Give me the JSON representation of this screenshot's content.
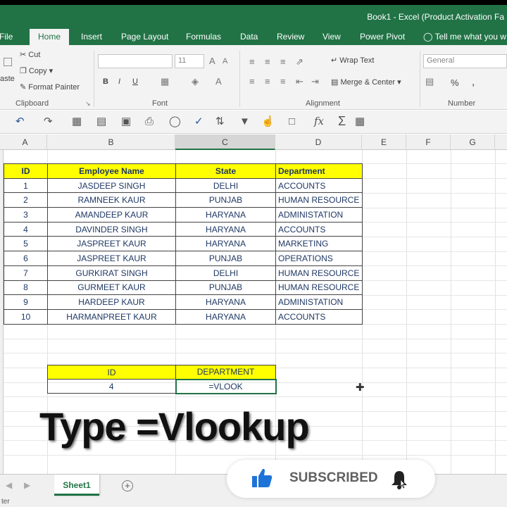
{
  "window": {
    "title": "Book1 - Excel (Product Activation Fa"
  },
  "tabs": [
    "File",
    "Home",
    "Insert",
    "Page Layout",
    "Formulas",
    "Data",
    "Review",
    "View",
    "Power Pivot",
    "Tell me what you w"
  ],
  "active_tab": "Home",
  "ribbon": {
    "clipboard": {
      "paste": "aste",
      "cut": "Cut",
      "copy": "Copy",
      "format_painter": "Format Painter",
      "group": "Clipboard"
    },
    "font": {
      "font_size": "11",
      "bold": "B",
      "italic": "I",
      "underline": "U",
      "group": "Font"
    },
    "alignment": {
      "wrap_text": "Wrap Text",
      "merge_center": "Merge & Center",
      "group": "Alignment"
    },
    "number": {
      "format": "General",
      "percent": "%",
      "comma": ",",
      "group": "Number"
    }
  },
  "grid": {
    "columns": [
      "A",
      "B",
      "C",
      "D",
      "E",
      "F",
      "G"
    ],
    "table_headers": [
      "ID",
      "Employee Name",
      "State",
      "Department"
    ],
    "rows": [
      [
        "1",
        "JASDEEP SINGH",
        "DELHI",
        "ACCOUNTS"
      ],
      [
        "2",
        "RAMNEEK KAUR",
        "PUNJAB",
        "HUMAN RESOURCE"
      ],
      [
        "3",
        "AMANDEEP KAUR",
        "HARYANA",
        "ADMINISTATION"
      ],
      [
        "4",
        "DAVINDER SINGH",
        "HARYANA",
        "ACCOUNTS"
      ],
      [
        "5",
        "JASPREET KAUR",
        "HARYANA",
        "MARKETING"
      ],
      [
        "6",
        "JASPREET KAUR",
        "PUNJAB",
        "OPERATIONS"
      ],
      [
        "7",
        "GURKIRAT SINGH",
        "DELHI",
        "HUMAN RESOURCE"
      ],
      [
        "8",
        "GURMEET KAUR",
        "PUNJAB",
        "HUMAN RESOURCE"
      ],
      [
        "9",
        "HARDEEP KAUR",
        "HARYANA",
        "ADMINISTATION"
      ],
      [
        "10",
        "HARMANPREET KAUR",
        "HARYANA",
        "ACCOUNTS"
      ]
    ],
    "lookup": {
      "id_header": "ID",
      "dept_header": "DEPARTMENT",
      "id_value": "4",
      "formula": "=VLOOK"
    }
  },
  "overlay_text": "Type =Vlookup",
  "sheet_tab": "Sheet1",
  "status_text": "ter",
  "subscribe_label": "SUBSCRIBED",
  "colors": {
    "excel_green": "#217346",
    "header_yellow": "#ffff00",
    "text_navy": "#1f3864"
  }
}
